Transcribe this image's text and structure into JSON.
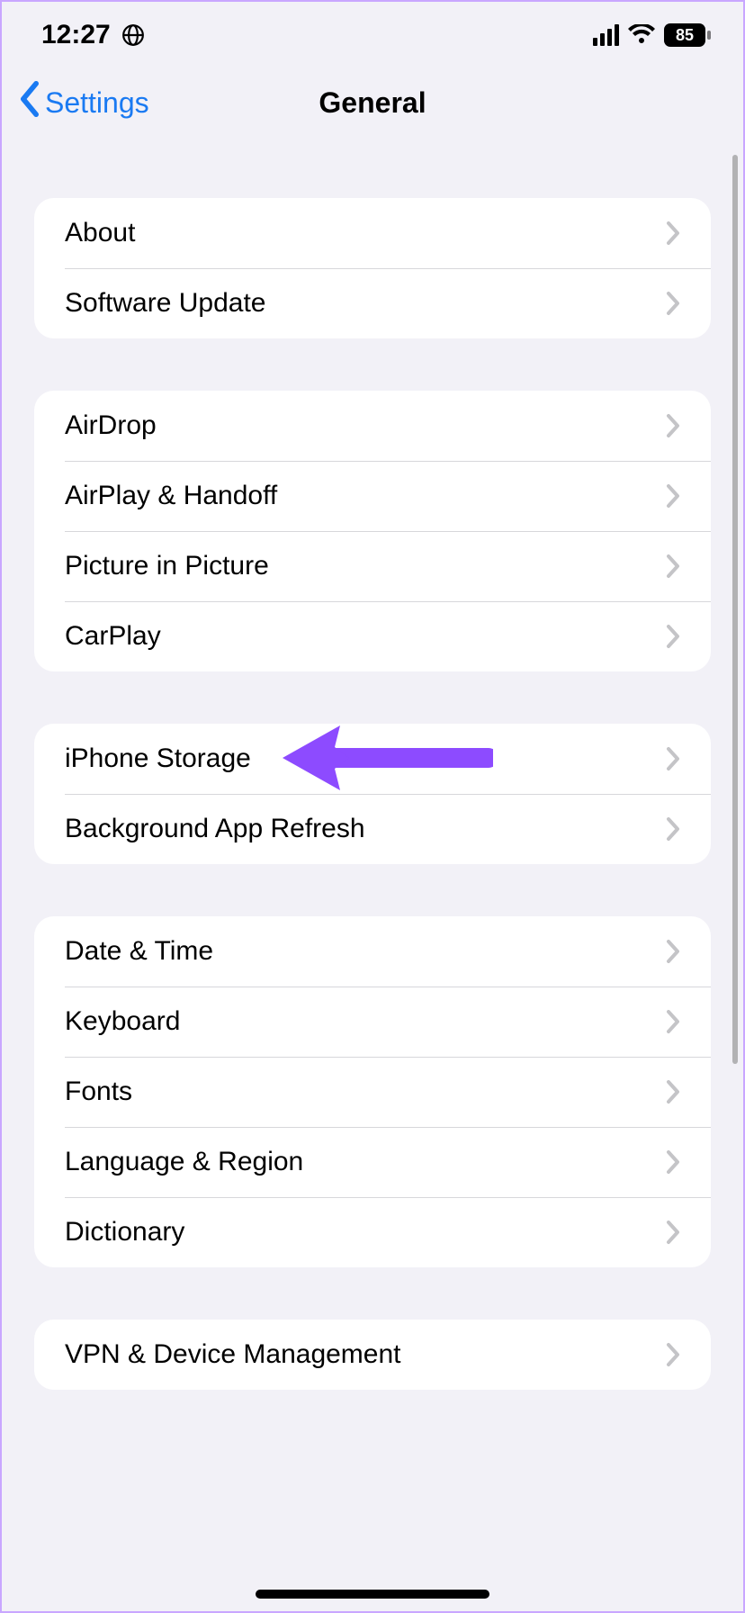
{
  "status": {
    "time": "12:27",
    "battery": "85"
  },
  "nav": {
    "back_label": "Settings",
    "title": "General"
  },
  "groups": [
    {
      "rows": [
        {
          "id": "about",
          "label": "About"
        },
        {
          "id": "software-update",
          "label": "Software Update"
        }
      ]
    },
    {
      "rows": [
        {
          "id": "airdrop",
          "label": "AirDrop"
        },
        {
          "id": "airplay-handoff",
          "label": "AirPlay & Handoff"
        },
        {
          "id": "picture-in-picture",
          "label": "Picture in Picture"
        },
        {
          "id": "carplay",
          "label": "CarPlay"
        }
      ]
    },
    {
      "rows": [
        {
          "id": "iphone-storage",
          "label": "iPhone Storage"
        },
        {
          "id": "background-app-refresh",
          "label": "Background App Refresh"
        }
      ]
    },
    {
      "rows": [
        {
          "id": "date-time",
          "label": "Date & Time"
        },
        {
          "id": "keyboard",
          "label": "Keyboard"
        },
        {
          "id": "fonts",
          "label": "Fonts"
        },
        {
          "id": "language-region",
          "label": "Language & Region"
        },
        {
          "id": "dictionary",
          "label": "Dictionary"
        }
      ]
    },
    {
      "rows": [
        {
          "id": "vpn-device-management",
          "label": "VPN & Device Management"
        }
      ]
    }
  ],
  "annotation": {
    "target_row": "iphone-storage",
    "color": "#8d4bff"
  }
}
